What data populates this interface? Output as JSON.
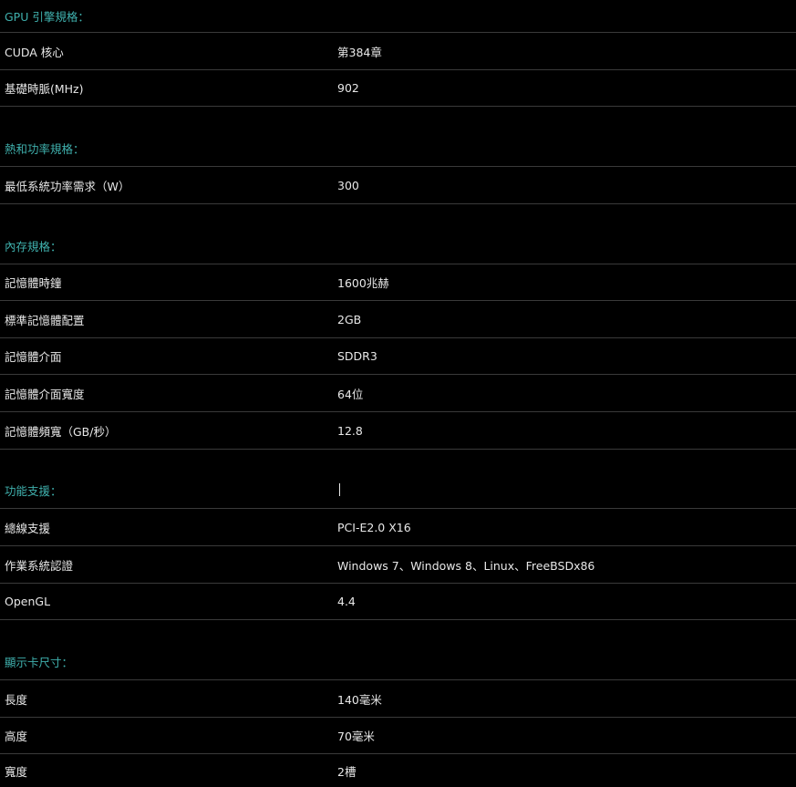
{
  "sections": [
    {
      "title": "GPU 引擎規格：",
      "rows": [
        {
          "label": "CUDA 核心",
          "value": "第384章"
        },
        {
          "label": "基礎時脈(MHz)",
          "value": "902"
        }
      ]
    },
    {
      "title": "熱和功率規格：",
      "rows": [
        {
          "label": "最低系統功率需求（W）",
          "value": "300"
        }
      ]
    },
    {
      "title": "內存規格：",
      "rows": [
        {
          "label": "記憶體時鐘",
          "value": "1600兆赫"
        },
        {
          "label": "標準記憶體配置",
          "value": "2GB"
        },
        {
          "label": "記憶體介面",
          "value": "SDDR3"
        },
        {
          "label": "記憶體介面寬度",
          "value": "64位"
        },
        {
          "label": "記憶體頻寬（GB/秒）",
          "value": "12.8"
        }
      ]
    },
    {
      "title": "功能支援：",
      "rows": [
        {
          "label": "總線支援",
          "value": "PCI-E2.0 X16"
        },
        {
          "label": "作業系統認證",
          "value": "Windows 7、Windows 8、Linux、FreeBSDx86"
        },
        {
          "label": "OpenGL",
          "value": "4.4"
        }
      ]
    },
    {
      "title": "顯示卡尺寸：",
      "rows": [
        {
          "label": "長度",
          "value": "140毫米"
        },
        {
          "label": "高度",
          "value": "70毫米"
        },
        {
          "label": "寬度",
          "value": "2槽"
        }
      ]
    }
  ]
}
